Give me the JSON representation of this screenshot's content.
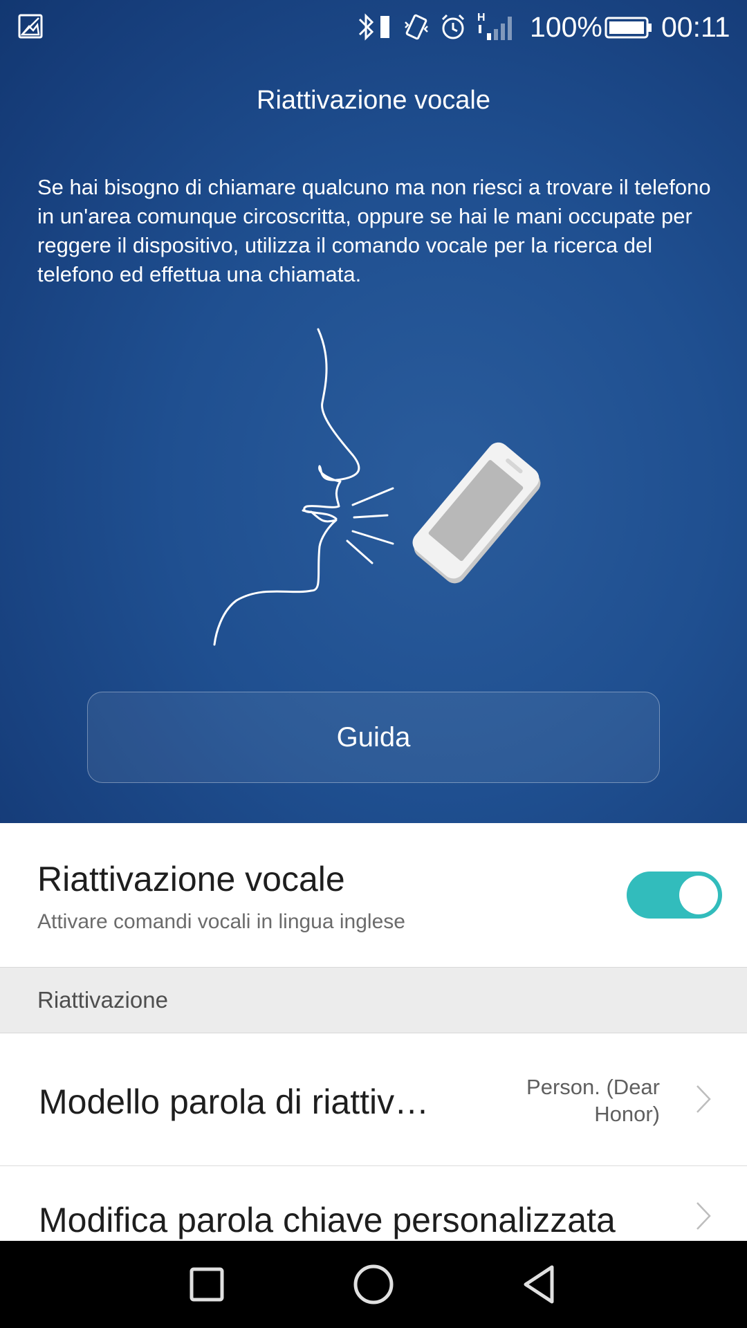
{
  "status_bar": {
    "left_icon": "image-notification-icon",
    "icons": [
      "bluetooth-icon",
      "vibrate-icon",
      "alarm-icon",
      "signal-icon",
      "battery-icon"
    ],
    "network_type": "H",
    "battery_percent": "100%",
    "time": "00:11"
  },
  "hero": {
    "title": "Riattivazione vocale",
    "description": "Se hai bisogno di chiamare qualcuno ma non riesci a trovare il telefono in un'area comunque circoscritta, oppure se hai le mani occupate per reggere il dispositivo, utilizza il comando vocale per la ricerca del telefono ed effettua una chiamata.",
    "illustration": "face-speaking-to-phone-illustration",
    "guide_button": "Guida"
  },
  "main_toggle": {
    "title": "Riattivazione vocale",
    "subtitle": "Attivare comandi vocali in lingua inglese",
    "enabled": true,
    "accent_color": "#32bcbc"
  },
  "section": {
    "header": "Riattivazione"
  },
  "rows": [
    {
      "title": "Modello parola di riattivazione",
      "value": "Person. (Dear Honor)"
    },
    {
      "title": "Modifica parola chiave personalizzata",
      "value": ""
    }
  ],
  "nav_bar": {
    "buttons": [
      "recents-square-icon",
      "home-circle-icon",
      "back-triangle-icon"
    ]
  }
}
